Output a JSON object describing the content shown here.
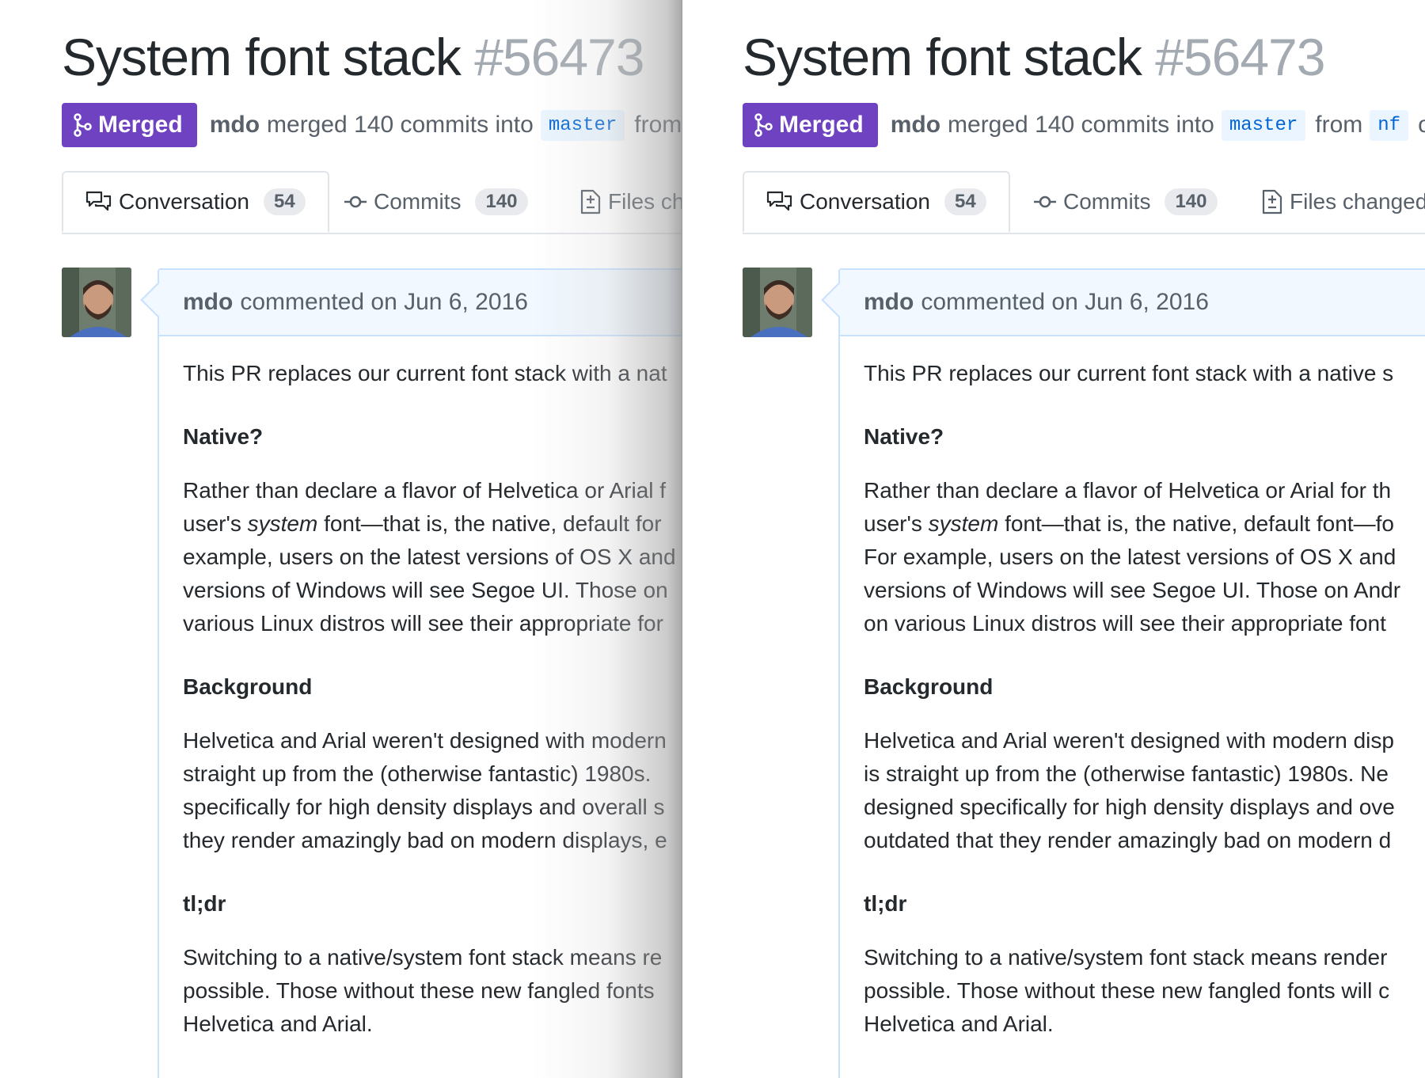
{
  "pr": {
    "title": "System font stack",
    "number": "#56473",
    "status": "Merged",
    "author": "mdo",
    "merged_text": "merged 140 commits into",
    "base_branch": "master",
    "from_text": "from",
    "head_branch": "nf",
    "on_text": "on",
    "left_head_branch_visible": "n"
  },
  "tabs": [
    {
      "label": "Conversation",
      "count": "54",
      "icon": "comment-discussion-icon"
    },
    {
      "label": "Commits",
      "count": "140",
      "icon": "git-commit-icon"
    },
    {
      "label": "Files changed",
      "icon": "diff-icon"
    }
  ],
  "left_tabs_visible": {
    "files_label": "Files ch"
  },
  "comment": {
    "author": "mdo",
    "action": "commented on Jun 6, 2016",
    "left": {
      "intro": "This PR replaces our current font stack with a nat",
      "h_native": "Native?",
      "native_lines": [
        "Rather than declare a flavor of Helvetica or Arial f",
        "user's",
        "system",
        "font—that is, the native, default for",
        "example, users on the latest versions of OS X and",
        "versions of Windows will see Segoe UI. Those on",
        "various Linux distros will see their appropriate for"
      ],
      "h_background": "Background",
      "background_lines": [
        "Helvetica and Arial weren't designed with modern",
        "straight up from the (otherwise fantastic) 1980s.",
        "specifically for high density displays and overall s",
        "they render amazingly bad on modern displays, e"
      ],
      "h_tldr": "tl;dr",
      "tldr_lines": [
        "Switching to a native/system font stack means re",
        "possible. Those without these new fangled fonts",
        "Helvetica and Arial."
      ]
    },
    "right": {
      "intro": "This PR replaces our current font stack with a native s",
      "h_native": "Native?",
      "native_lines": [
        "Rather than declare a flavor of Helvetica or Arial for th",
        "user's",
        "system",
        "font—that is, the native, default font—fo",
        "For example, users on the latest versions of OS X and",
        "versions of Windows will see Segoe UI. Those on Andr",
        "on various Linux distros will see their appropriate font"
      ],
      "h_background": "Background",
      "background_lines": [
        "Helvetica and Arial weren't designed with modern disp",
        "is straight up from the (otherwise fantastic) 1980s. Ne",
        "designed specifically for high density displays and ove",
        "outdated that they render amazingly bad on modern d"
      ],
      "h_tldr": "tl;dr",
      "tldr_lines": [
        "Switching to a native/system font stack means render",
        "possible. Those without these new fangled fonts will c",
        "Helvetica and Arial."
      ]
    }
  },
  "colors": {
    "merged_badge": "#6f42c1",
    "branch_bg": "#eaf5ff",
    "branch_text": "#0366d6",
    "comment_header_bg": "#f1f8ff",
    "comment_border": "#c8e1ff"
  }
}
